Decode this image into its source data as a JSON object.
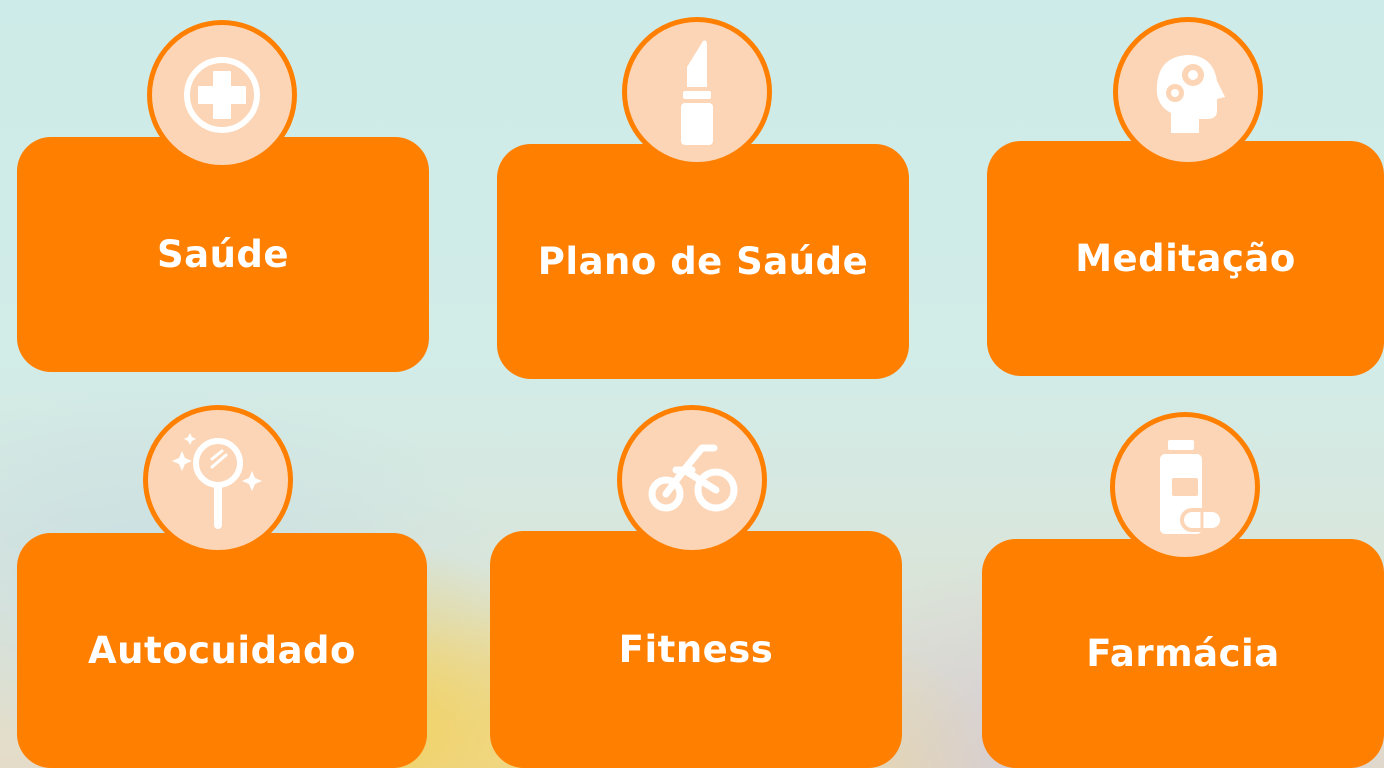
{
  "colors": {
    "card": "#ff7f00",
    "badge_fill": "#fbd5b5",
    "label": "#ffffff"
  },
  "cards": [
    {
      "label": "Saúde",
      "icon": "medical-cross-icon"
    },
    {
      "label": "Plano de Saúde",
      "icon": "lipstick-icon"
    },
    {
      "label": "Meditação",
      "icon": "head-gears-icon"
    },
    {
      "label": "Autocuidado",
      "icon": "sparkling-mirror-icon"
    },
    {
      "label": "Fitness",
      "icon": "bicycle-icon"
    },
    {
      "label": "Farmácia",
      "icon": "medicine-bottle-icon"
    }
  ]
}
